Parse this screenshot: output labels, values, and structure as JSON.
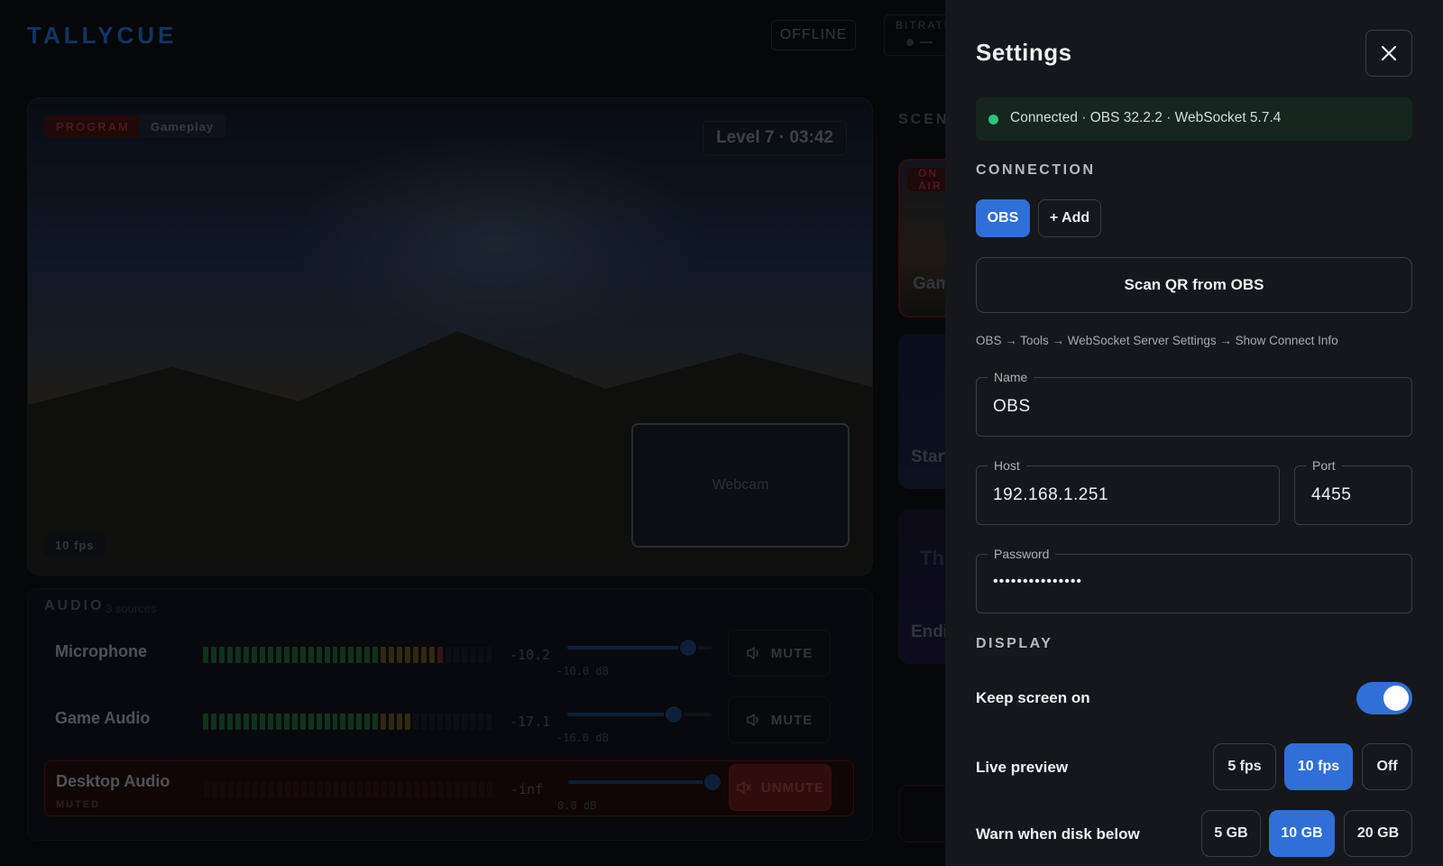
{
  "app": {
    "logo": "TALLYCUE",
    "status": "OFFLINE",
    "bitrate_label": "BITRATE"
  },
  "program": {
    "tag": "PROGRAM",
    "scene": "Gameplay",
    "level_badge": "Level 7 · 03:42",
    "webcam_label": "Webcam",
    "fps_badge": "10 fps"
  },
  "audio": {
    "title": "AUDIO",
    "subtitle": "3 sources",
    "sources": [
      {
        "name": "Microphone",
        "db": "-10.2",
        "slider_label": "-10.0 dB",
        "level": 0.83,
        "volume": 0.84,
        "button": "MUTE",
        "muted": false
      },
      {
        "name": "Game Audio",
        "db": "-17.1",
        "slider_label": "-16.0 dB",
        "level": 0.72,
        "volume": 0.74,
        "button": "MUTE",
        "muted": false
      },
      {
        "name": "Desktop Audio",
        "sub": "MUTED",
        "db": "-inf",
        "slider_label": "0.0 dB",
        "level": 0.0,
        "volume": 1.0,
        "button": "UNMUTE",
        "muted": true
      }
    ]
  },
  "scenes": {
    "title": "SCENES",
    "on_air_tag": "ON AIR",
    "items": [
      "Gameplay",
      "Starting",
      "Ending"
    ],
    "card_text": "Th"
  },
  "settings": {
    "title": "Settings",
    "status": "Connected · OBS 32.2.2 · WebSocket 5.7.4",
    "connection_heading": "CONNECTION",
    "connection_tabs": [
      "OBS"
    ],
    "add_label": "+ Add",
    "scan_label": "Scan QR from OBS",
    "hint": "OBS → Tools → WebSocket Server Settings → Show Connect Info",
    "name_label": "Name",
    "name_value": "OBS",
    "host_label": "Host",
    "host_value": "192.168.1.251",
    "port_label": "Port",
    "port_value": "4455",
    "password_label": "Password",
    "password_value": "•••••••••••••••",
    "display_heading": "DISPLAY",
    "keep_screen_label": "Keep screen on",
    "keep_screen_on": true,
    "live_preview_label": "Live preview",
    "live_preview_options": [
      "5 fps",
      "10 fps",
      "Off"
    ],
    "live_preview_selected": "10 fps",
    "warn_disk_label": "Warn when disk below",
    "warn_disk_options": [
      "5 GB",
      "10 GB",
      "20 GB"
    ],
    "warn_disk_selected": "10 GB"
  },
  "colors": {
    "accent": "#2f6fd6",
    "connected": "#2ec27e",
    "program_red": "#8b2c2c",
    "drawer_bg": "#15171b"
  },
  "icons": {
    "close": "close-icon",
    "speaker": "speaker-icon",
    "speaker_muted": "speaker-muted-icon"
  }
}
